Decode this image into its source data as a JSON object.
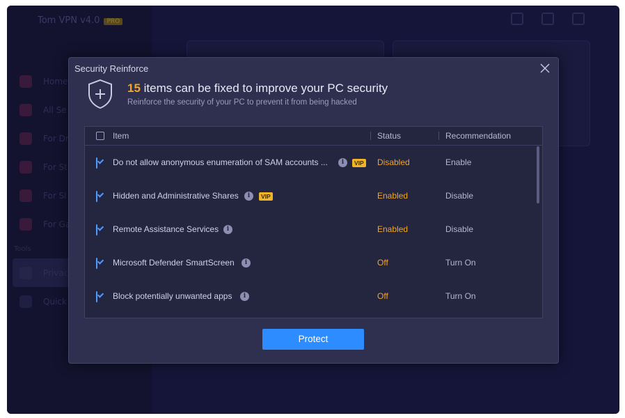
{
  "app": {
    "title": "Tom VPN v4.0",
    "badge": "PRO",
    "nav": [
      "Home",
      "All Se",
      "For Dr",
      "For St",
      "For Sl",
      "For Ga"
    ],
    "section": "Tools",
    "tools": [
      "Privac",
      "Quick"
    ]
  },
  "dialog": {
    "title": "Security Reinforce",
    "count": "15",
    "headline_rest": " items can be fixed to improve your PC security",
    "subtitle": "Reinforce the security of your PC to prevent it from being hacked",
    "columns": {
      "item": "Item",
      "status": "Status",
      "recommendation": "Recommendation"
    },
    "rows": [
      {
        "name": "Do not allow anonymous enumeration of SAM accounts ...",
        "vip": "VIP",
        "status": "Disabled",
        "recommendation": "Enable"
      },
      {
        "name": "Hidden and Administrative Shares",
        "vip": "VIP",
        "status": "Enabled",
        "recommendation": "Disable"
      },
      {
        "name": "Remote Assistance Services",
        "vip": "",
        "status": "Enabled",
        "recommendation": "Disable"
      },
      {
        "name": "Microsoft Defender SmartScreen",
        "vip": "",
        "status": "Off",
        "recommendation": "Turn On"
      },
      {
        "name": "Block potentially unwanted apps",
        "vip": "",
        "status": "Off",
        "recommendation": "Turn On"
      }
    ],
    "protect_label": "Protect"
  },
  "colors": {
    "accent": "#2d8cff",
    "status": "#f5a524",
    "vip": "#f0b429",
    "dialog_bg": "#2f3050"
  },
  "icons": [
    "close-icon",
    "shield-plus-icon",
    "info-icon",
    "checkbox-icon"
  ]
}
